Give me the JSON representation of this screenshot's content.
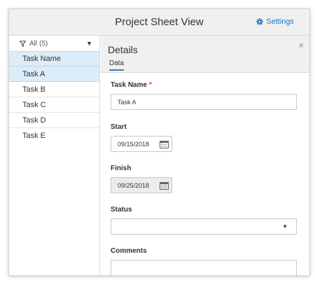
{
  "header": {
    "title": "Project Sheet View",
    "settings_label": "Settings"
  },
  "sidebar": {
    "filter_label": "All",
    "filter_count": "(5)",
    "column_header": "Task Name",
    "tasks": [
      "Task A",
      "Task B",
      "Task C",
      "Task D",
      "Task E"
    ]
  },
  "details": {
    "title": "Details",
    "tab_label": "Data",
    "close_glyph": "×",
    "task_name_label": "Task Name",
    "required_marker": "*",
    "task_name_value": "Task A",
    "start_label": "Start",
    "start_value": "09/15/2018",
    "finish_label": "Finish",
    "finish_value": "09/25/2018",
    "status_label": "Status",
    "status_value": "",
    "comments_label": "Comments",
    "comments_value": ""
  },
  "colors": {
    "accent": "#1f78c8",
    "selection": "#dcecf8",
    "required": "#d9342b"
  }
}
